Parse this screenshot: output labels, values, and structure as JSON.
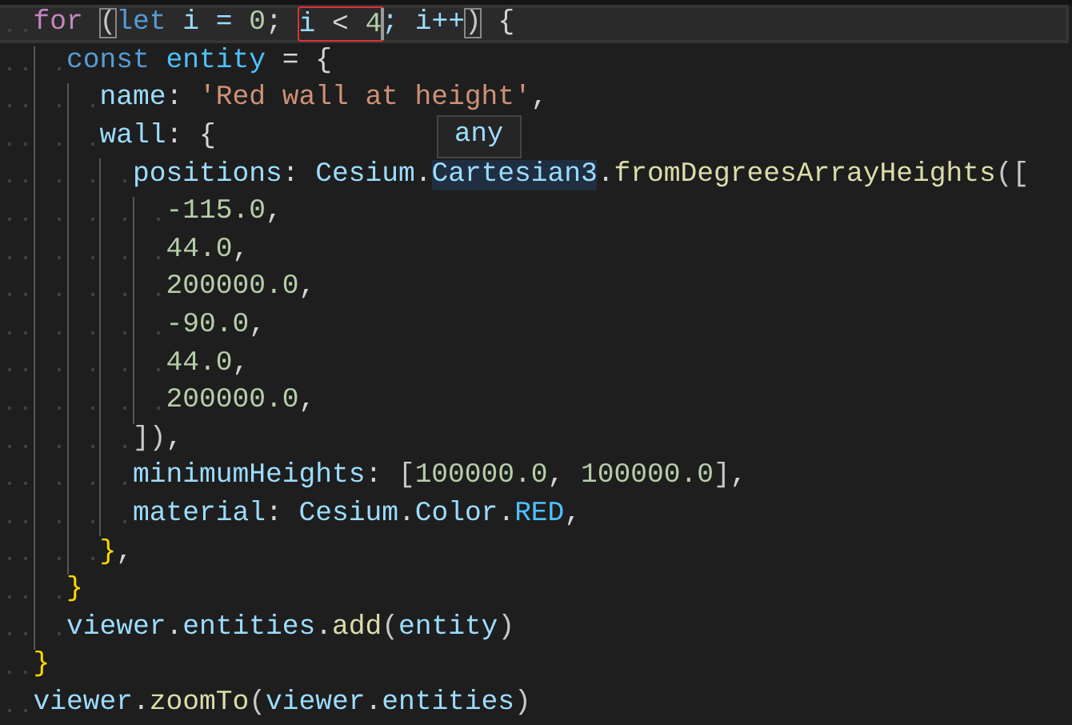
{
  "tooltip": {
    "text": "any"
  },
  "lines": [
    {
      "current": true,
      "tokens": [
        {
          "text": "for ",
          "kind": "control"
        },
        {
          "text": "(",
          "kind": "paren",
          "matched": true
        },
        {
          "text": "let",
          "kind": "keyword"
        },
        {
          "text": " i = ",
          "kind": "var"
        },
        {
          "text": "0",
          "kind": "number"
        },
        {
          "text": "; ",
          "kind": "plain"
        },
        {
          "kind": "group",
          "error": true,
          "tokens": [
            {
              "text": "i",
              "kind": "var"
            },
            {
              "text": " < ",
              "kind": "plain"
            },
            {
              "text": "4",
              "kind": "number"
            }
          ]
        },
        {
          "text": "; i++",
          "kind": "var"
        },
        {
          "text": ")",
          "kind": "paren",
          "matched": true
        },
        {
          "text": " {",
          "kind": "plain"
        }
      ],
      "children": [
        {
          "current": false,
          "tokens": [
            {
              "text": "const",
              "kind": "keyword"
            },
            {
              "text": " entity",
              "kind": "const"
            },
            {
              "text": " = {",
              "kind": "plain"
            }
          ],
          "children": [
            {
              "current": false,
              "tokens": [
                {
                  "text": "name",
                  "kind": "var"
                },
                {
                  "text": ": ",
                  "kind": "plain"
                },
                {
                  "text": "'Red wall at height'",
                  "kind": "string"
                },
                {
                  "text": ",",
                  "kind": "plain"
                }
              ]
            },
            {
              "current": false,
              "tokens": [
                {
                  "text": "wall",
                  "kind": "var"
                },
                {
                  "text": ": {",
                  "kind": "plain"
                }
              ],
              "children": [
                {
                  "current": false,
                  "tokens": [
                    {
                      "text": "positions",
                      "kind": "var"
                    },
                    {
                      "text": ": ",
                      "kind": "plain"
                    },
                    {
                      "text": "Cesium",
                      "kind": "var"
                    },
                    {
                      "text": ".",
                      "kind": "plain"
                    },
                    {
                      "text": "Cartesian3",
                      "kind": "var",
                      "highlighted": true
                    },
                    {
                      "text": ".",
                      "kind": "plain"
                    },
                    {
                      "text": "fromDegreesArrayHeights",
                      "kind": "function"
                    },
                    {
                      "text": "([",
                      "kind": "paren"
                    }
                  ],
                  "children": [
                    {
                      "current": false,
                      "tokens": [
                        {
                          "text": "-115.0",
                          "kind": "number"
                        },
                        {
                          "text": ",",
                          "kind": "plain"
                        }
                      ]
                    },
                    {
                      "current": false,
                      "tokens": [
                        {
                          "text": "44.0",
                          "kind": "number"
                        },
                        {
                          "text": ",",
                          "kind": "plain"
                        }
                      ]
                    },
                    {
                      "current": false,
                      "tokens": [
                        {
                          "text": "200000.0",
                          "kind": "number"
                        },
                        {
                          "text": ",",
                          "kind": "plain"
                        }
                      ]
                    },
                    {
                      "current": false,
                      "tokens": [
                        {
                          "text": "-90.0",
                          "kind": "number"
                        },
                        {
                          "text": ",",
                          "kind": "plain"
                        }
                      ]
                    },
                    {
                      "current": false,
                      "tokens": [
                        {
                          "text": "44.0",
                          "kind": "number"
                        },
                        {
                          "text": ",",
                          "kind": "plain"
                        }
                      ]
                    },
                    {
                      "current": false,
                      "tokens": [
                        {
                          "text": "200000.0",
                          "kind": "number"
                        },
                        {
                          "text": ",",
                          "kind": "plain"
                        }
                      ]
                    }
                  ]
                },
                {
                  "current": false,
                  "tokens": [
                    {
                      "text": "])",
                      "kind": "paren"
                    },
                    {
                      "text": ",",
                      "kind": "plain"
                    }
                  ]
                },
                {
                  "current": false,
                  "tokens": [
                    {
                      "text": "minimumHeights",
                      "kind": "var"
                    },
                    {
                      "text": ": ",
                      "kind": "plain"
                    },
                    {
                      "text": "[",
                      "kind": "paren"
                    },
                    {
                      "text": "100000.0",
                      "kind": "number"
                    },
                    {
                      "text": ", ",
                      "kind": "plain"
                    },
                    {
                      "text": "100000.0",
                      "kind": "number"
                    },
                    {
                      "text": "]",
                      "kind": "paren"
                    },
                    {
                      "text": ",",
                      "kind": "plain"
                    }
                  ]
                },
                {
                  "current": false,
                  "tokens": [
                    {
                      "text": "material",
                      "kind": "var"
                    },
                    {
                      "text": ": ",
                      "kind": "plain"
                    },
                    {
                      "text": "Cesium",
                      "kind": "var"
                    },
                    {
                      "text": ".",
                      "kind": "plain"
                    },
                    {
                      "text": "Color",
                      "kind": "var"
                    },
                    {
                      "text": ".",
                      "kind": "plain"
                    },
                    {
                      "text": "RED",
                      "kind": "const"
                    },
                    {
                      "text": ",",
                      "kind": "plain"
                    }
                  ]
                }
              ]
            },
            {
              "current": false,
              "tokens": [
                {
                  "text": "}",
                  "kind": "brace"
                },
                {
                  "text": ",",
                  "kind": "plain"
                }
              ]
            }
          ]
        },
        {
          "current": false,
          "tokens": [
            {
              "text": "}",
              "kind": "brace"
            }
          ]
        },
        {
          "current": false,
          "tokens": [
            {
              "text": "viewer",
              "kind": "var"
            },
            {
              "text": ".",
              "kind": "plain"
            },
            {
              "text": "entities",
              "kind": "var"
            },
            {
              "text": ".",
              "kind": "plain"
            },
            {
              "text": "add",
              "kind": "function"
            },
            {
              "text": "(",
              "kind": "paren"
            },
            {
              "text": "entity",
              "kind": "var"
            },
            {
              "text": ")",
              "kind": "paren"
            }
          ]
        }
      ]
    },
    {
      "current": false,
      "tokens": [
        {
          "text": "}",
          "kind": "brace"
        }
      ]
    },
    {
      "current": false,
      "tokens": [
        {
          "text": "viewer",
          "kind": "var"
        },
        {
          "text": ".",
          "kind": "plain"
        },
        {
          "text": "zoomTo",
          "kind": "function"
        },
        {
          "text": "(",
          "kind": "paren"
        },
        {
          "text": "viewer",
          "kind": "var"
        },
        {
          "text": ".",
          "kind": "plain"
        },
        {
          "text": "entities",
          "kind": "var"
        },
        {
          "text": ")",
          "kind": "paren"
        }
      ]
    }
  ]
}
